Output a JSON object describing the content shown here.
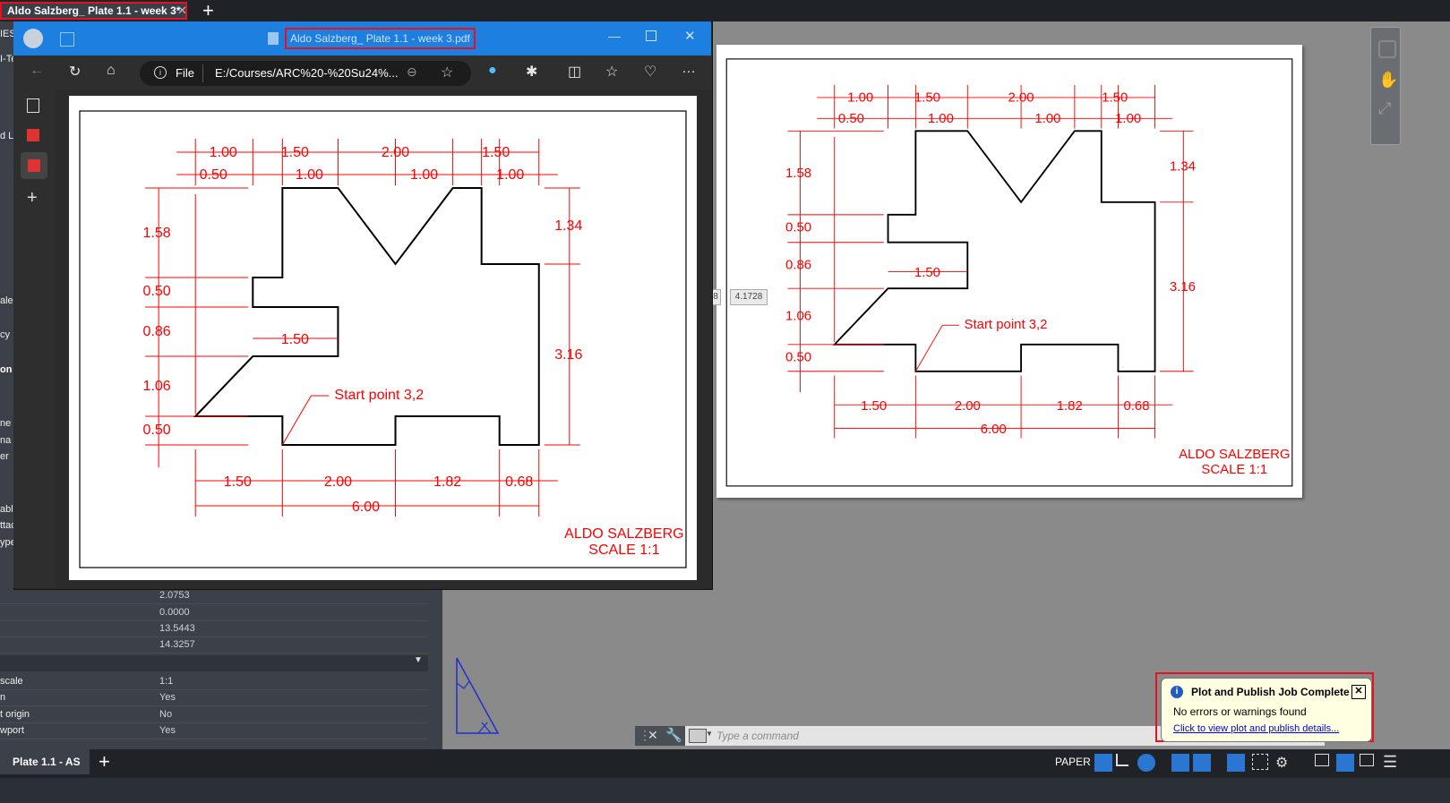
{
  "tab": {
    "title": "Aldo Salzberg_ Plate 1.1 - week 3*"
  },
  "props": {
    "values": [
      "2.0753",
      "0.0000",
      "13.5443",
      "14.3257"
    ],
    "rows": [
      {
        "label": "scale",
        "value": "1:1"
      },
      {
        "label": "n",
        "value": "Yes"
      },
      {
        "label": "t origin",
        "value": "No"
      },
      {
        "label": "wport",
        "value": "Yes"
      }
    ],
    "left_fragments": [
      "IES",
      "I-Te",
      "d La",
      "ale",
      "cy",
      "on",
      "ne",
      "na",
      "er",
      "able",
      "ttac",
      "ype"
    ]
  },
  "pdf": {
    "title": "Aldo Salzberg_ Plate 1.1 - week 3.pdf",
    "file_label": "File",
    "url": "E:/Courses/ARC%20-%20Su24%..."
  },
  "drawing": {
    "dims_top": [
      "1.00",
      "1.50",
      "2.00",
      "1.50"
    ],
    "dims_top2": [
      "0.50",
      "1.00",
      "1.00",
      "1.00"
    ],
    "dims_left": [
      "1.58",
      "0.50",
      "0.86",
      "1.06",
      "0.50"
    ],
    "dims_right": [
      "1.34",
      "3.16"
    ],
    "dims_bottom": [
      "1.50",
      "2.00",
      "1.82",
      "0.68"
    ],
    "total": "6.00",
    "notch": "1.50",
    "start": "Start point 3,2",
    "name": "ALDO SALZBERG",
    "scale": "SCALE 1:1"
  },
  "coord": {
    "value": "4.1728",
    "prefix": "8"
  },
  "cmd": {
    "placeholder": "Type  a  command"
  },
  "status": {
    "layout_tab": "Plate 1.1 - AS",
    "paper": "PAPER"
  },
  "notify": {
    "title": "Plot and Publish Job Complete",
    "line1": "No errors or warnings found",
    "link": "Click to view plot and publish details..."
  },
  "colors": {
    "dim": "#ff0000",
    "accent": "#1d7fe0",
    "highlight": "#e8121f"
  }
}
